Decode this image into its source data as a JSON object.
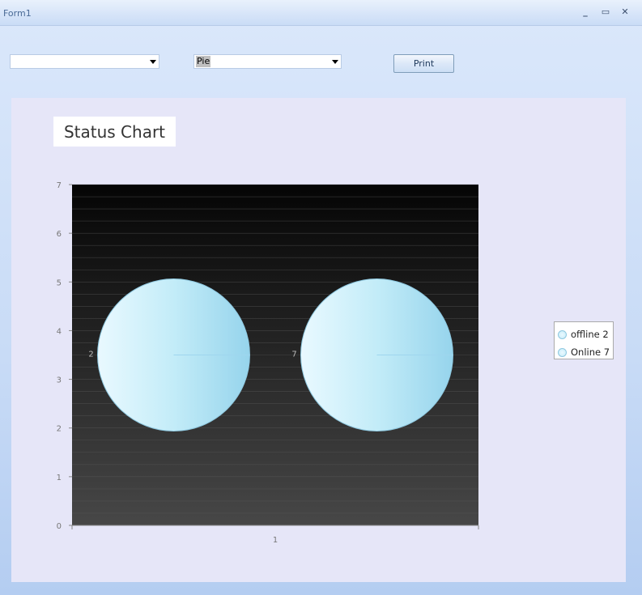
{
  "window": {
    "title": "Form1",
    "minimize": "_",
    "maximize": "▭",
    "close": "✕"
  },
  "toolbar": {
    "combo1_value": "",
    "combo2_value": "Pie",
    "print_label": "Print"
  },
  "colors": {
    "panel_bg": "#e6e6f8",
    "pie_fill": "#c6ecf8",
    "pie_edge": "#8ec8e0"
  },
  "chart_data": {
    "type": "pie",
    "title": "Status Chart",
    "categories": [
      "1"
    ],
    "ylim": [
      0,
      7
    ],
    "y_ticks": [
      "0",
      "1",
      "2",
      "3",
      "4",
      "5",
      "6",
      "7"
    ],
    "x_ticks": [
      "1"
    ],
    "series": [
      {
        "name": "offline",
        "value": 2,
        "label": "2"
      },
      {
        "name": "Online",
        "value": 7,
        "label": "7"
      }
    ],
    "legend": [
      {
        "label": "offline 2"
      },
      {
        "label": "Online 7"
      }
    ],
    "legend_position": "right"
  }
}
